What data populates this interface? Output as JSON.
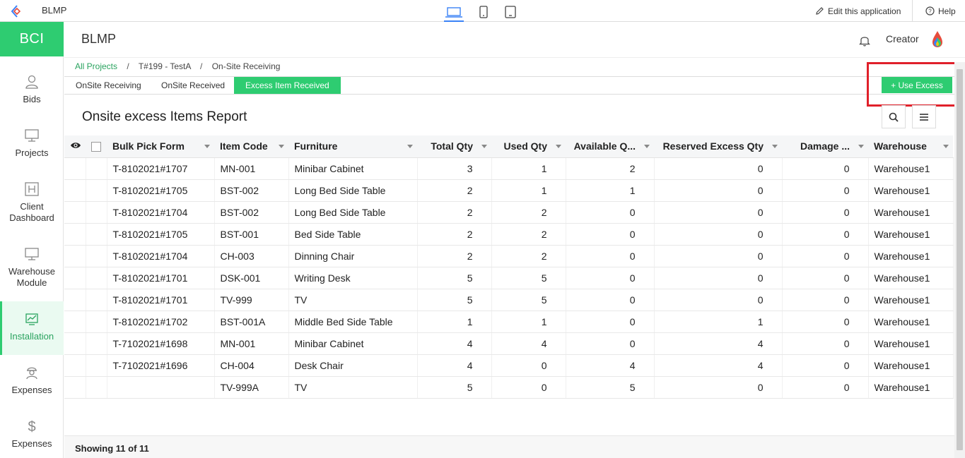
{
  "topbar": {
    "app_name": "BLMP",
    "edit_label": "Edit this application",
    "help_label": "Help"
  },
  "sidebar": {
    "brand": "BCI",
    "items": [
      {
        "label": "Bids",
        "icon": "user-icon"
      },
      {
        "label": "Projects",
        "icon": "monitor-icon"
      },
      {
        "label": "Client Dashboard",
        "icon": "h-box-icon"
      },
      {
        "label": "Warehouse Module",
        "icon": "monitor-icon"
      },
      {
        "label": "Installation",
        "icon": "chart-icon",
        "active": true
      },
      {
        "label": "Expenses",
        "icon": "worker-icon"
      },
      {
        "label": "Expenses",
        "icon": "dollar-icon"
      }
    ]
  },
  "header": {
    "title": "BLMP",
    "user": "Creator"
  },
  "breadcrumb": {
    "items": [
      "All Projects",
      "T#199 - TestA",
      "On-Site Receiving"
    ]
  },
  "tabs": [
    {
      "label": "OnSite Receiving"
    },
    {
      "label": "OnSite Received"
    },
    {
      "label": "Excess Item Received",
      "active": true
    }
  ],
  "use_excess_label": "+ Use Excess",
  "report": {
    "title": "Onsite excess Items Report",
    "columns": [
      "Bulk Pick Form",
      "Item Code",
      "Furniture",
      "Total Qty",
      "Used Qty",
      "Available Q...",
      "Reserved Excess Qty",
      "Damage ...",
      "Warehouse"
    ],
    "rows": [
      [
        "T-8102021#1707",
        "MN-001",
        "Minibar Cabinet",
        "3",
        "1",
        "2",
        "0",
        "0",
        "Warehouse1"
      ],
      [
        "T-8102021#1705",
        "BST-002",
        "Long Bed Side Table",
        "2",
        "1",
        "1",
        "0",
        "0",
        "Warehouse1"
      ],
      [
        "T-8102021#1704",
        "BST-002",
        "Long Bed Side Table",
        "2",
        "2",
        "0",
        "0",
        "0",
        "Warehouse1"
      ],
      [
        "T-8102021#1705",
        "BST-001",
        "Bed Side Table",
        "2",
        "2",
        "0",
        "0",
        "0",
        "Warehouse1"
      ],
      [
        "T-8102021#1704",
        "CH-003",
        "Dinning Chair",
        "2",
        "2",
        "0",
        "0",
        "0",
        "Warehouse1"
      ],
      [
        "T-8102021#1701",
        "DSK-001",
        "Writing Desk",
        "5",
        "5",
        "0",
        "0",
        "0",
        "Warehouse1"
      ],
      [
        "T-8102021#1701",
        "TV-999",
        "TV",
        "5",
        "5",
        "0",
        "0",
        "0",
        "Warehouse1"
      ],
      [
        "T-8102021#1702",
        "BST-001A",
        "Middle Bed Side Table",
        "1",
        "1",
        "0",
        "1",
        "0",
        "Warehouse1"
      ],
      [
        "T-7102021#1698",
        "MN-001",
        "Minibar Cabinet",
        "4",
        "4",
        "0",
        "4",
        "0",
        "Warehouse1"
      ],
      [
        "T-7102021#1696",
        "CH-004",
        "Desk Chair",
        "4",
        "0",
        "4",
        "4",
        "0",
        "Warehouse1"
      ],
      [
        "",
        "TV-999A",
        "TV",
        "5",
        "0",
        "5",
        "0",
        "0",
        "Warehouse1"
      ]
    ],
    "footer": "Showing 11 of 11"
  },
  "colors": {
    "accent": "#2ecc71",
    "highlight": "#e0202a"
  }
}
